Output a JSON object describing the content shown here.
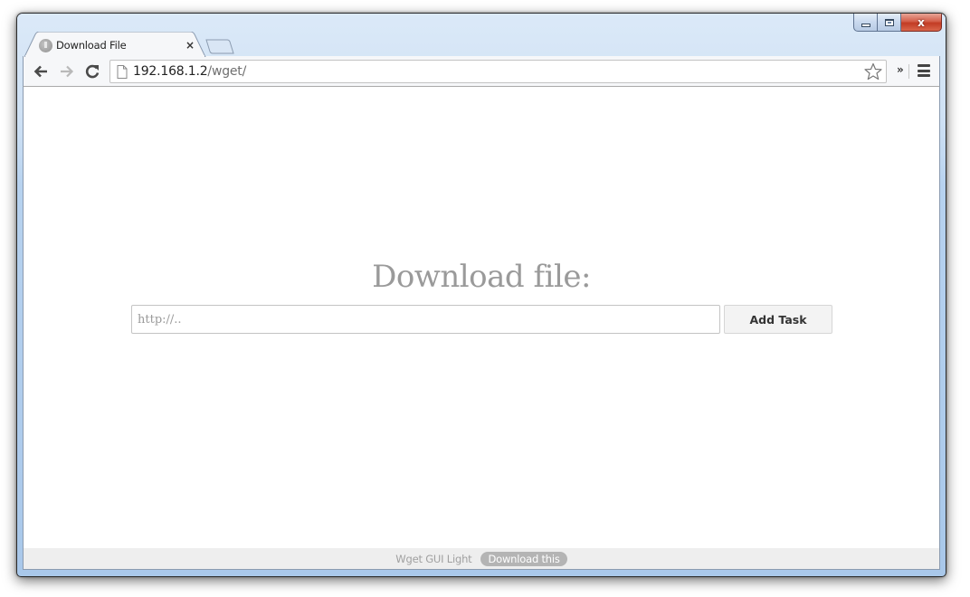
{
  "window": {
    "caption_buttons": {
      "minimize": "minimize",
      "maximize": "maximize",
      "close": "x"
    }
  },
  "browser": {
    "tabs": [
      {
        "title": "Download File",
        "active": true,
        "favicon": "globe-icon",
        "close_glyph": "×"
      }
    ],
    "new_tab": "new-tab-icon",
    "address_bar": {
      "host": "192.168.1.2",
      "path": "/wget/"
    },
    "toolbar": {
      "overflow_glyph": "»"
    }
  },
  "page": {
    "heading": "Download file:",
    "url_input": {
      "value": "",
      "placeholder": "http://.."
    },
    "add_button": "Add Task",
    "footer": {
      "brand": "Wget GUI Light",
      "link": "Download this"
    }
  }
}
